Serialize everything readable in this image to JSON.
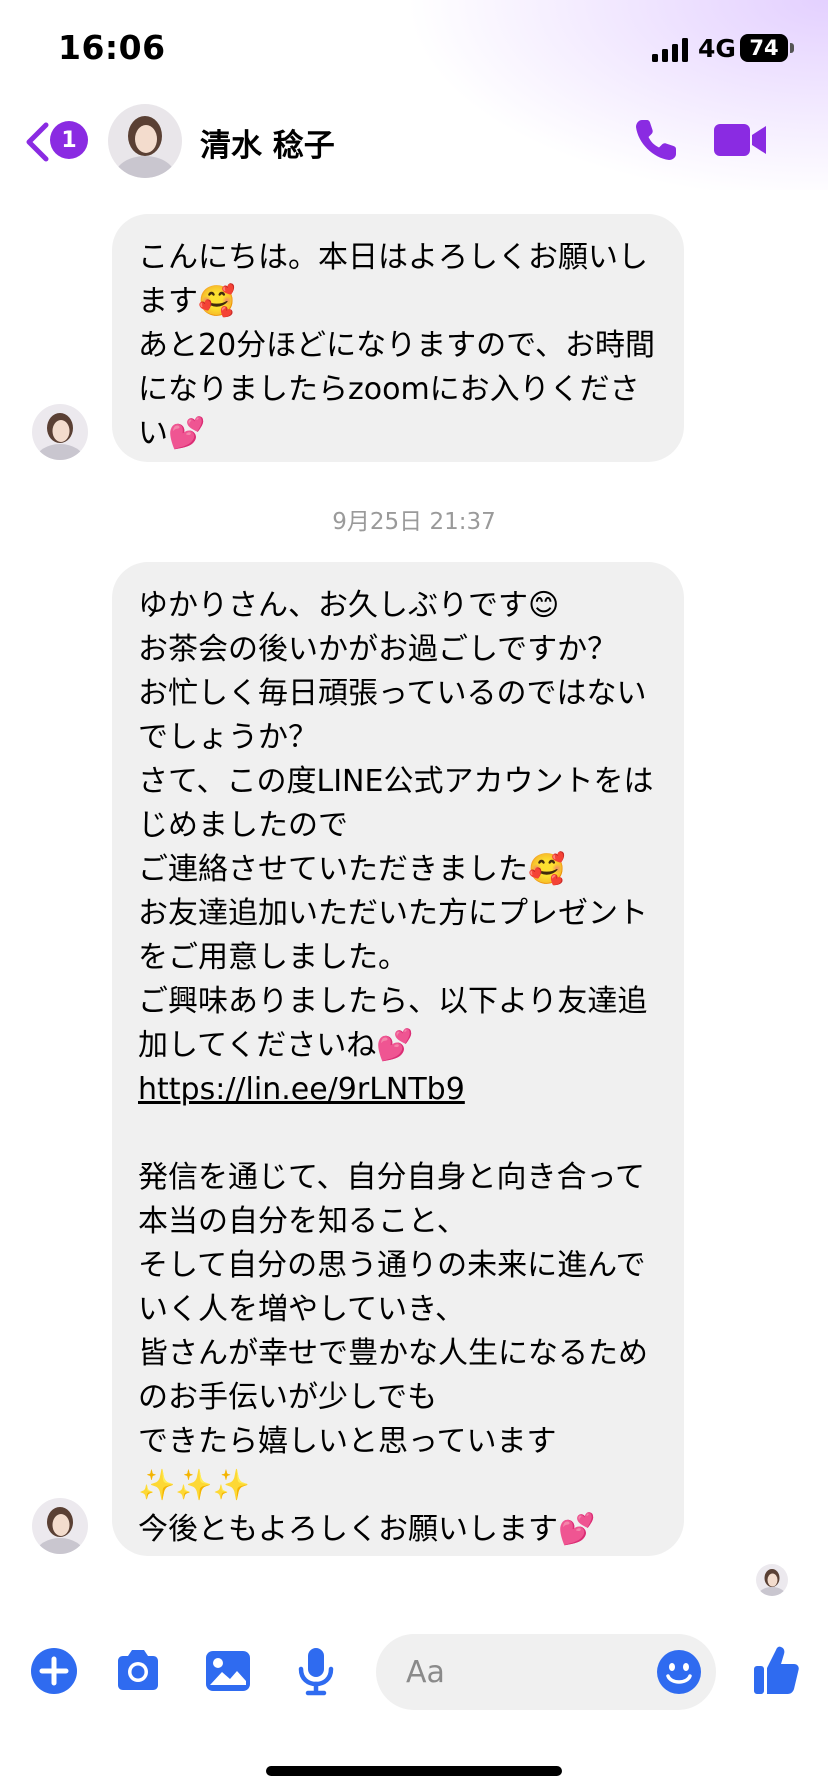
{
  "status_bar": {
    "time": "16:06",
    "network": "4G",
    "battery": "74"
  },
  "header": {
    "back_badge": "1",
    "contact_name": "清水 稔子"
  },
  "messages": [
    {
      "text": "こんにちは。本日はよろしくお願いします🥰\nあと20分ほどになりますので、お時間になりましたらzoomにお入りください💕"
    }
  ],
  "timestamp": "9月25日 21:37",
  "message2": {
    "before_link": "ゆかりさん、お久しぶりです😊\nお茶会の後いかがお過ごしですか？\nお忙しく毎日頑張っているのではないでしょうか？\nさて、この度LINE公式アカウントをはじめましたので\nご連絡させていただきました🥰\nお友達追加いただいた方にプレゼントをご用意しました。\nご興味ありましたら、以下より友達追加してくださいね💕\n",
    "link": "https://lin.ee/9rLNTb9",
    "after_link": "\n\n発信を通じて、自分自身と向き合って本当の自分を知ること、\nそして自分の思う通りの未来に進んでいく人を増やしていき、\n皆さんが幸せで豊かな人生になるためのお手伝いが少しでも\nできたら嬉しいと思っています\n✨✨✨\n今後ともよろしくお願いします💕"
  },
  "composer": {
    "placeholder": "Aa"
  },
  "colors": {
    "accent_purple": "#8a2be2",
    "accent_blue": "#2f6bf0",
    "bubble_gray": "#f0f0f0"
  },
  "icons": [
    "chevron-left-icon",
    "phone-icon",
    "video-camera-icon",
    "plus-circle-icon",
    "camera-icon",
    "photo-icon",
    "microphone-icon",
    "emoji-icon",
    "thumbs-up-icon"
  ]
}
